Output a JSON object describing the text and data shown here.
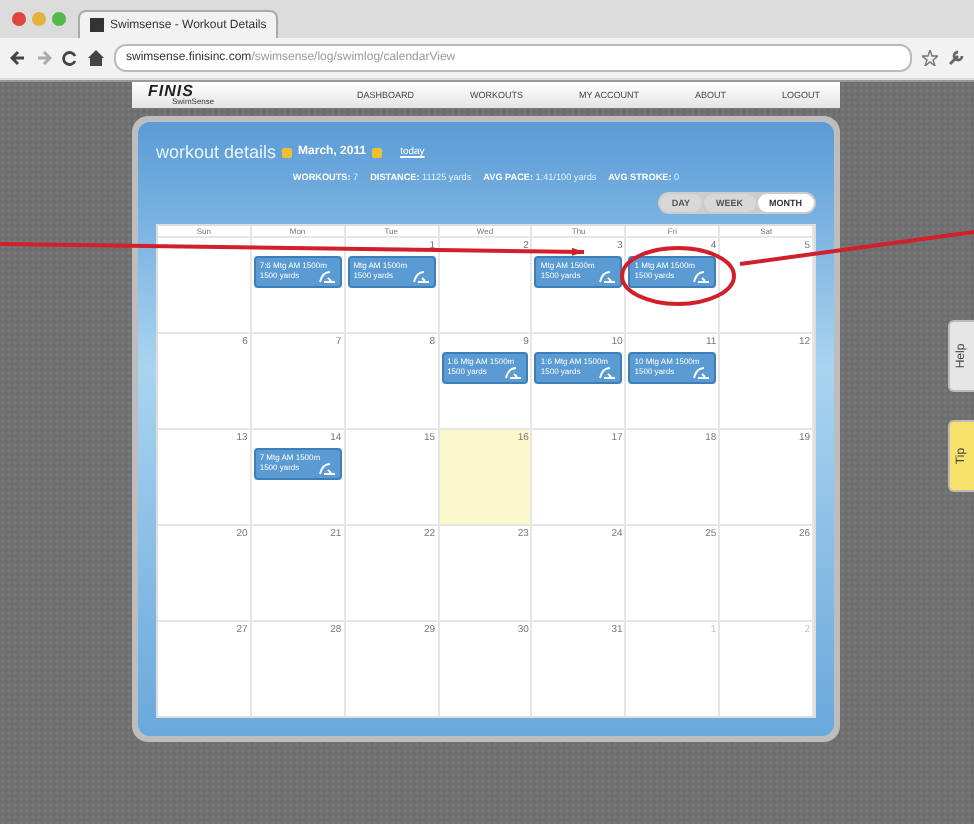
{
  "browser": {
    "tab_title": "Swimsense - Workout Details",
    "url_host": "swimsense.finisinc.com",
    "url_path": "/swimsense/log/swimlog/calendarView"
  },
  "nav": {
    "logo": "FINIS",
    "logo_sub": "SwimSense",
    "items": [
      "DASHBOARD",
      "WORKOUTS",
      "MY ACCOUNT",
      "ABOUT",
      "LOGOUT"
    ]
  },
  "header": {
    "title": "workout details",
    "month": "March, 2011",
    "today_link": "today"
  },
  "stats": [
    {
      "label": "WORKOUTS:",
      "value": "7"
    },
    {
      "label": "DISTANCE:",
      "value": "11125 yards"
    },
    {
      "label": "AVG PACE:",
      "value": "1:41/100 yards"
    },
    {
      "label": "AVG STROKE:",
      "value": "0"
    }
  ],
  "views": [
    {
      "label": "DAY",
      "selected": false
    },
    {
      "label": "WEEK",
      "selected": false
    },
    {
      "label": "MONTH",
      "selected": true
    }
  ],
  "calendar": {
    "weekdays": [
      "Sun",
      "Mon",
      "Tue",
      "Wed",
      "Thu",
      "Fri",
      "Sat"
    ],
    "weeks": [
      [
        {
          "kind": "blank",
          "today": false
        },
        {
          "kind": "blank",
          "today": false,
          "events": [
            {
              "time": "7:6 Mtg AM 1500m",
              "distance": "1500 yards"
            }
          ]
        },
        {
          "day": "1",
          "kind": "day",
          "today": false,
          "events": [
            {
              "time": "Mtg AM 1500m",
              "distance": "1500 yards"
            }
          ]
        },
        {
          "day": "2",
          "kind": "day",
          "today": false
        },
        {
          "day": "3",
          "kind": "day",
          "today": false,
          "events": [
            {
              "time": "Mtg AM 1500m",
              "distance": "1500 yards"
            }
          ]
        },
        {
          "day": "4",
          "kind": "day",
          "today": false,
          "events": [
            {
              "time": "1 Mtg AM 1500m",
              "distance": "1500 yards"
            }
          ]
        },
        {
          "day": "5",
          "kind": "day",
          "today": false
        }
      ],
      [
        {
          "day": "6",
          "kind": "day",
          "today": false
        },
        {
          "day": "7",
          "kind": "day",
          "today": false
        },
        {
          "day": "8",
          "kind": "day",
          "today": false
        },
        {
          "day": "9",
          "kind": "day",
          "today": false,
          "events": [
            {
              "time": "1:6 Mtg AM 1500m",
              "distance": "1500 yards"
            }
          ]
        },
        {
          "day": "10",
          "kind": "day",
          "today": false,
          "events": [
            {
              "time": "1:6 Mtg AM 1500m",
              "distance": "1500 yards"
            }
          ]
        },
        {
          "day": "11",
          "kind": "day",
          "today": false,
          "events": [
            {
              "time": "10 Mtg AM 1500m",
              "distance": "1500 yards"
            }
          ]
        },
        {
          "day": "12",
          "kind": "day",
          "today": false
        }
      ],
      [
        {
          "day": "13",
          "kind": "day",
          "today": false
        },
        {
          "day": "14",
          "kind": "day",
          "today": false,
          "events": [
            {
              "time": "7 Mtg AM 1500m",
              "distance": "1500 yards"
            }
          ]
        },
        {
          "day": "15",
          "kind": "day",
          "today": false
        },
        {
          "day": "16",
          "kind": "day",
          "today": true
        },
        {
          "day": "17",
          "kind": "day",
          "today": false
        },
        {
          "day": "18",
          "kind": "day",
          "today": false
        },
        {
          "day": "19",
          "kind": "day",
          "today": false
        }
      ],
      [
        {
          "day": "20",
          "kind": "day",
          "today": false
        },
        {
          "day": "21",
          "kind": "day",
          "today": false
        },
        {
          "day": "22",
          "kind": "day",
          "today": false
        },
        {
          "day": "23",
          "kind": "day",
          "today": false
        },
        {
          "day": "24",
          "kind": "day",
          "today": false
        },
        {
          "day": "25",
          "kind": "day",
          "today": false
        },
        {
          "day": "26",
          "kind": "day",
          "today": false
        }
      ],
      [
        {
          "day": "27",
          "kind": "day",
          "today": false
        },
        {
          "day": "28",
          "kind": "day",
          "today": false
        },
        {
          "day": "29",
          "kind": "day",
          "today": false
        },
        {
          "day": "30",
          "kind": "day",
          "today": false
        },
        {
          "day": "31",
          "kind": "day",
          "today": false
        },
        {
          "day": "1",
          "kind": "other",
          "today": false
        },
        {
          "day": "2",
          "kind": "other",
          "today": false
        }
      ]
    ]
  },
  "side_tabs": [
    {
      "label": "Help",
      "kind": "grey"
    },
    {
      "label": "Tip",
      "kind": "yellow"
    }
  ]
}
